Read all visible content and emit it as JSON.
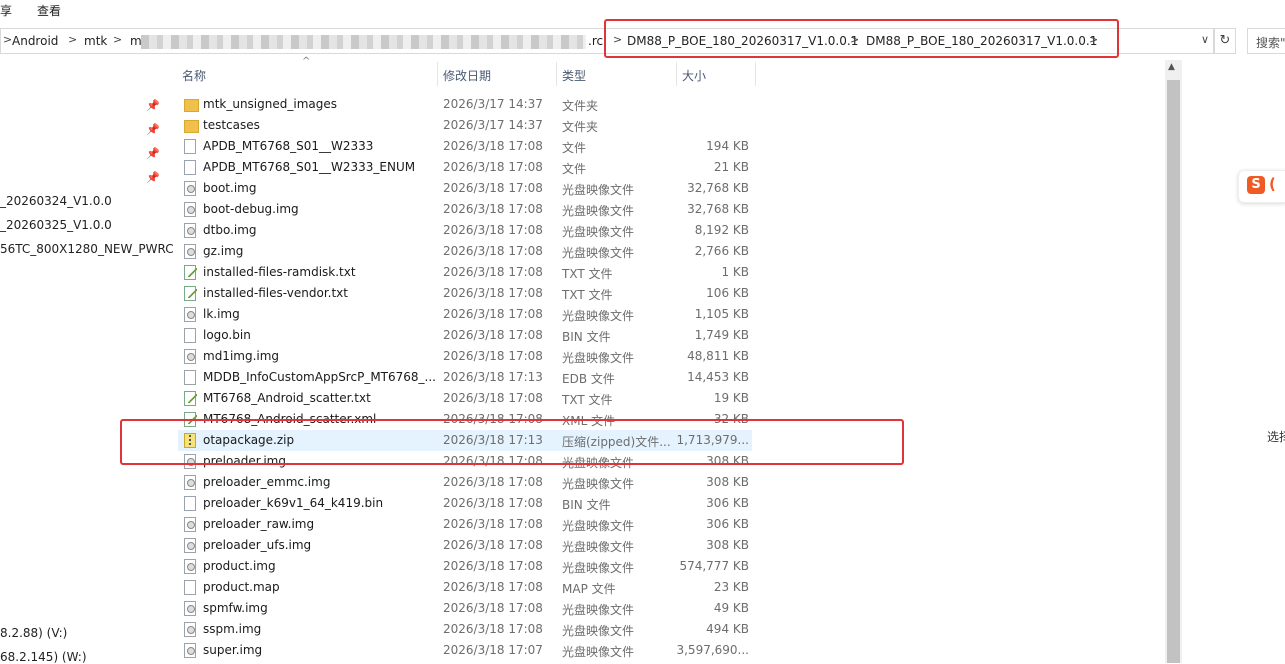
{
  "ribbon": {
    "share": "享",
    "view": "查看"
  },
  "address": {
    "crumbs": [
      "Android",
      "mtk",
      "m",
      ".rc",
      "DM88_P_BOE_180_20260317_V1.0.0.1",
      "DM88_P_BOE_180_20260317_V1.0.0.1"
    ],
    "chevron": ">",
    "dropdown": "∨",
    "refresh": "↻"
  },
  "search": {
    "placeholder": "搜索\""
  },
  "nav": {
    "items": [
      "_20260324_V1.0.0",
      "_20260325_V1.0.0",
      "56TC_800X1280_NEW_PWRC",
      "8.2.88) (V:)",
      "68.2.145) (W:)"
    ],
    "pin": "📌"
  },
  "columns": {
    "name": "名称",
    "date": "修改日期",
    "type": "类型",
    "size": "大小",
    "sort_arrow": "^"
  },
  "files": [
    {
      "name": "mtk_unsigned_images",
      "date": "2026/3/17 14:37",
      "type": "文件夹",
      "size": "",
      "icon": "folder"
    },
    {
      "name": "testcases",
      "date": "2026/3/17 14:37",
      "type": "文件夹",
      "size": "",
      "icon": "folder"
    },
    {
      "name": "APDB_MT6768_S01__W2333",
      "date": "2026/3/18 17:08",
      "type": "文件",
      "size": "194 KB",
      "icon": "file"
    },
    {
      "name": "APDB_MT6768_S01__W2333_ENUM",
      "date": "2026/3/18 17:08",
      "type": "文件",
      "size": "21 KB",
      "icon": "file"
    },
    {
      "name": "boot.img",
      "date": "2026/3/18 17:08",
      "type": "光盘映像文件",
      "size": "32,768 KB",
      "icon": "disc"
    },
    {
      "name": "boot-debug.img",
      "date": "2026/3/18 17:08",
      "type": "光盘映像文件",
      "size": "32,768 KB",
      "icon": "disc"
    },
    {
      "name": "dtbo.img",
      "date": "2026/3/18 17:08",
      "type": "光盘映像文件",
      "size": "8,192 KB",
      "icon": "disc"
    },
    {
      "name": "gz.img",
      "date": "2026/3/18 17:08",
      "type": "光盘映像文件",
      "size": "2,766 KB",
      "icon": "disc"
    },
    {
      "name": "installed-files-ramdisk.txt",
      "date": "2026/3/18 17:08",
      "type": "TXT 文件",
      "size": "1 KB",
      "icon": "txt"
    },
    {
      "name": "installed-files-vendor.txt",
      "date": "2026/3/18 17:08",
      "type": "TXT 文件",
      "size": "106 KB",
      "icon": "txt"
    },
    {
      "name": "lk.img",
      "date": "2026/3/18 17:08",
      "type": "光盘映像文件",
      "size": "1,105 KB",
      "icon": "disc"
    },
    {
      "name": "logo.bin",
      "date": "2026/3/18 17:08",
      "type": "BIN 文件",
      "size": "1,749 KB",
      "icon": "file"
    },
    {
      "name": "md1img.img",
      "date": "2026/3/18 17:08",
      "type": "光盘映像文件",
      "size": "48,811 KB",
      "icon": "disc"
    },
    {
      "name": "MDDB_InfoCustomAppSrcP_MT6768_...",
      "date": "2026/3/18 17:13",
      "type": "EDB 文件",
      "size": "14,453 KB",
      "icon": "file"
    },
    {
      "name": "MT6768_Android_scatter.txt",
      "date": "2026/3/18 17:08",
      "type": "TXT 文件",
      "size": "19 KB",
      "icon": "txt"
    },
    {
      "name": "MT6768_Android_scatter.xml",
      "date": "2026/3/18 17:08",
      "type": "XML 文件",
      "size": "32 KB",
      "icon": "txt"
    },
    {
      "name": "otapackage.zip",
      "date": "2026/3/18 17:13",
      "type": "压缩(zipped)文件...",
      "size": "1,713,979...",
      "icon": "zip",
      "selected": true
    },
    {
      "name": "preloader.img",
      "date": "2026/3/18 17:08",
      "type": "光盘映像文件",
      "size": "308 KB",
      "icon": "disc"
    },
    {
      "name": "preloader_emmc.img",
      "date": "2026/3/18 17:08",
      "type": "光盘映像文件",
      "size": "308 KB",
      "icon": "disc"
    },
    {
      "name": "preloader_k69v1_64_k419.bin",
      "date": "2026/3/18 17:08",
      "type": "BIN 文件",
      "size": "306 KB",
      "icon": "file"
    },
    {
      "name": "preloader_raw.img",
      "date": "2026/3/18 17:08",
      "type": "光盘映像文件",
      "size": "306 KB",
      "icon": "disc"
    },
    {
      "name": "preloader_ufs.img",
      "date": "2026/3/18 17:08",
      "type": "光盘映像文件",
      "size": "308 KB",
      "icon": "disc"
    },
    {
      "name": "product.img",
      "date": "2026/3/18 17:08",
      "type": "光盘映像文件",
      "size": "574,777 KB",
      "icon": "disc"
    },
    {
      "name": "product.map",
      "date": "2026/3/18 17:08",
      "type": "MAP 文件",
      "size": "23 KB",
      "icon": "file"
    },
    {
      "name": "spmfw.img",
      "date": "2026/3/18 17:08",
      "type": "光盘映像文件",
      "size": "49 KB",
      "icon": "disc"
    },
    {
      "name": "sspm.img",
      "date": "2026/3/18 17:08",
      "type": "光盘映像文件",
      "size": "494 KB",
      "icon": "disc"
    },
    {
      "name": "super.img",
      "date": "2026/3/18 17:07",
      "type": "光盘映像文件",
      "size": "3,597,690...",
      "icon": "disc"
    }
  ],
  "sogou": {
    "s": "S",
    "c": "("
  },
  "preview_hint": "选择",
  "colors": {
    "highlight_box": "#e0333a",
    "selected_row": "#e5f3ff"
  }
}
